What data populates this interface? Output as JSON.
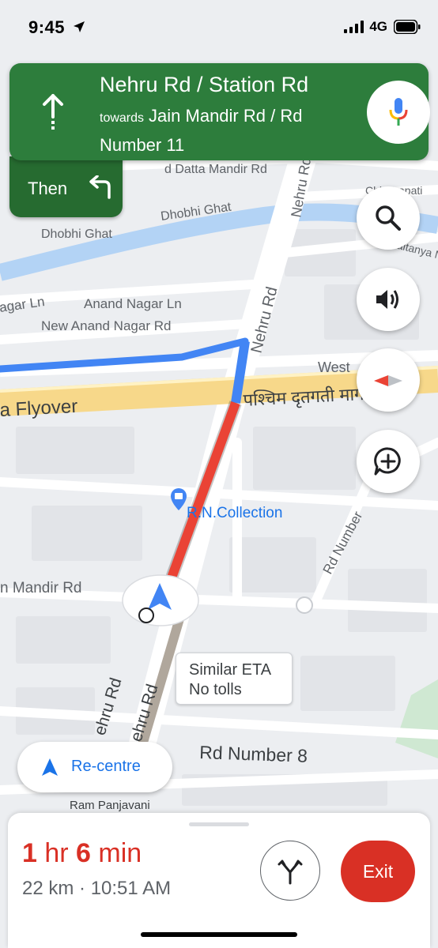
{
  "status_bar": {
    "time": "9:45",
    "network": "4G"
  },
  "navigation": {
    "street": "Nehru Rd / Station Rd",
    "towards_prefix": "towards",
    "towards_road": "Jain Mandir Rd / Rd Number 11",
    "then_label": "Then",
    "next_turn": "left",
    "card_color": "#2d7d3c"
  },
  "map": {
    "labels": {
      "nehru_rd_upper": "Nehru Rd",
      "nehru_rd_mid": "Nehru Rd",
      "nehru_rd_low1": "ehru Rd",
      "nehru_rd_low2": "ehru Rd",
      "dhobhi_ghat_1": "Dhobhi Ghat",
      "dhobhi_ghat_2": "Dhobhi Ghat",
      "datta_mandir": "d Datta Mandir Rd",
      "chhatrapati": "Chhatrapati",
      "chaitanya": "Chaitanya Na",
      "nagar_ln": "agar Ln",
      "anand_nagar_ln": "Anand Nagar Ln",
      "new_anand_nagar": "New Anand Nagar Rd",
      "west": "West",
      "flyover": "a Flyover",
      "flyover_hindi": "पश्चिम दृतगती मार्ग",
      "rn_collection": "R.N.Collection",
      "rd_number": "Rd Number",
      "jain_mandir": "n Mandir Rd",
      "rd_number_8": "Rd Number 8",
      "ram_panjavani": "Ram Panjavani"
    },
    "route_colors": {
      "blue": "#4285f4",
      "heavy_traffic": "#ea4335",
      "alternate": "#b0a79c"
    }
  },
  "route_bubble": {
    "line1": "Similar ETA",
    "line2": "No tolls"
  },
  "controls": {
    "search_icon": "search-icon",
    "sound_icon": "volume-icon",
    "compass_icon": "compass-icon",
    "report_icon": "add-report-icon",
    "recentre_label": "Re-centre"
  },
  "trip": {
    "hours": "1",
    "hours_unit": " hr ",
    "minutes": "6",
    "minutes_unit": " min",
    "distance": "22 km",
    "separator": " · ",
    "arrival": "10:51 AM",
    "exit_label": "Exit",
    "duration_color": "#d93025"
  }
}
